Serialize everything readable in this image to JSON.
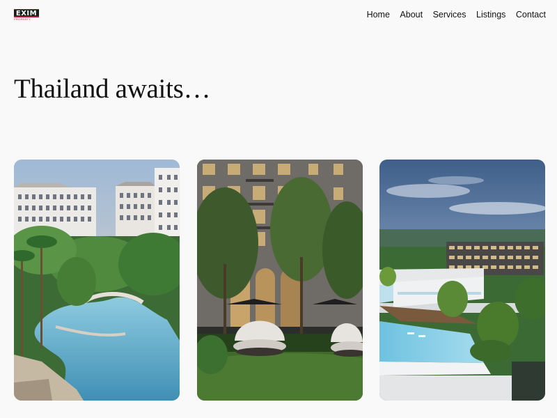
{
  "logo": {
    "mark": "EXIM",
    "sub": "PROPERTY"
  },
  "nav": {
    "items": [
      {
        "label": "Home"
      },
      {
        "label": "About"
      },
      {
        "label": "Services"
      },
      {
        "label": "Listings"
      },
      {
        "label": "Contact"
      }
    ]
  },
  "hero": {
    "title": "Thailand awaits…"
  },
  "colors": {
    "background": "#f9f9f9",
    "brand_red": "#c8102e",
    "text": "#111111"
  }
}
